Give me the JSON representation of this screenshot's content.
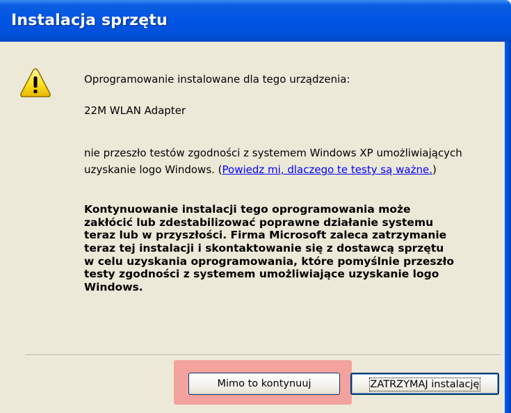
{
  "window": {
    "title": "Instalacja sprzętu"
  },
  "icons": {
    "warning": "warning-icon",
    "accent_blue": "#0054e3",
    "warning_yellow": "#ffe020"
  },
  "message": {
    "heading": "Oprogramowanie instalowane dla tego urządzenia:",
    "device_name": "22M WLAN Adapter",
    "not_tested_line1": "nie przeszło testów zgodności z systemem Windows XP umożliwiających",
    "not_tested_line2_prefix": "uzyskanie logo Windows. (",
    "why_link": "Powiedz mi, dlaczego te testy są ważne.",
    "not_tested_line2_suffix": ")",
    "warning_lines": [
      "Kontynuowanie instalacji tego oprogramowania może",
      "zakłócić lub zdestabilizować poprawne działanie systemu",
      "teraz lub w przyszłości. Firma Microsoft zaleca zatrzymanie",
      "teraz tej instalacji i skontaktowanie się z dostawcą sprzętu",
      "w celu uzyskania oprogramowania, które pomyślnie przeszło",
      "testy zgodności z systemem umożliwiające uzyskanie logo",
      "Windows."
    ]
  },
  "buttons": {
    "continue_label": "Mimo to kontynuuj",
    "stop_label": "ZATRZYMAJ instalację"
  }
}
